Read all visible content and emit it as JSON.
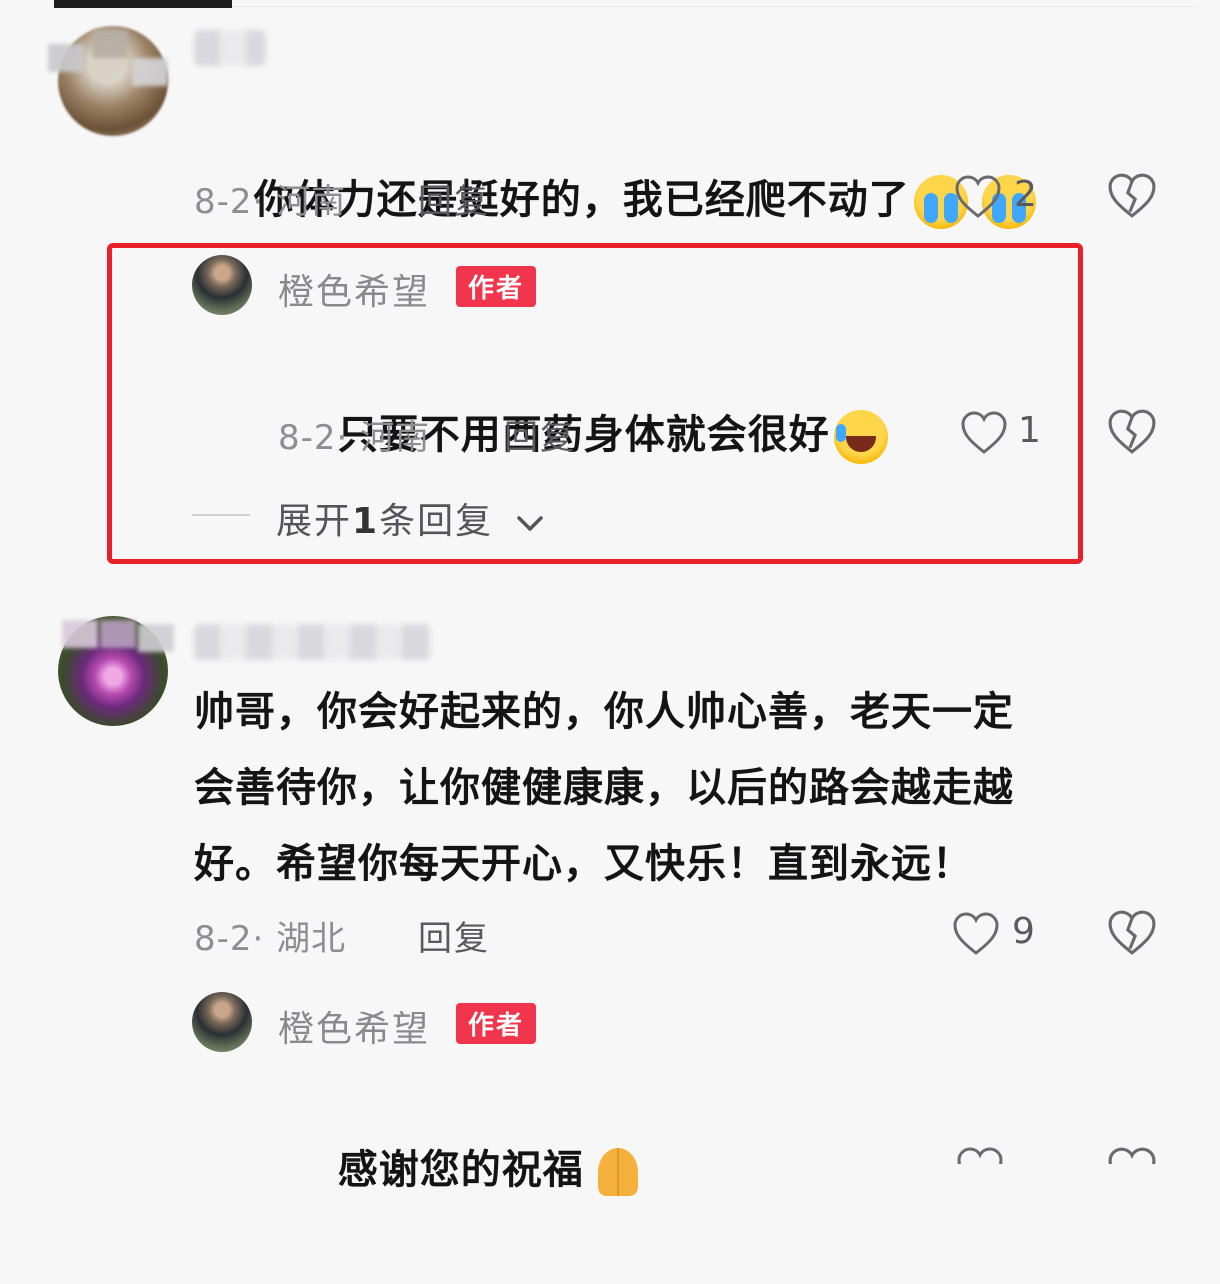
{
  "comments": [
    {
      "text": "你体力还是挺好的，我已经爬不动了",
      "emoji": [
        "loudly-crying-face",
        "loudly-crying-face"
      ],
      "date_location": "8-2· 河南",
      "reply_label": "回复",
      "likes": "2",
      "reply": {
        "author": "橙色希望",
        "badge": "作者",
        "text": "只要不用西药身体就会很好",
        "emoji": "rolling-on-floor-laughing",
        "date_location": "8-2· 河南",
        "reply_label": "回复",
        "likes": "1",
        "expand_prefix": "展开",
        "expand_count": "1",
        "expand_suffix": "条回复"
      }
    },
    {
      "text": "帅哥，你会好起来的，你人帅心善，老天一定\n会善待你，让你健健康康，以后的路会越走越\n好。希望你每天开心，又快乐！直到永远！",
      "date_location": "8-2· 湖北",
      "reply_label": "回复",
      "likes": "9",
      "reply": {
        "author": "橙色希望",
        "badge": "作者",
        "text": "感谢您的祝福",
        "emoji": "folded-hands"
      }
    }
  ],
  "colors": {
    "highlight_box": "#e8202a",
    "author_badge": "#f0354c"
  }
}
